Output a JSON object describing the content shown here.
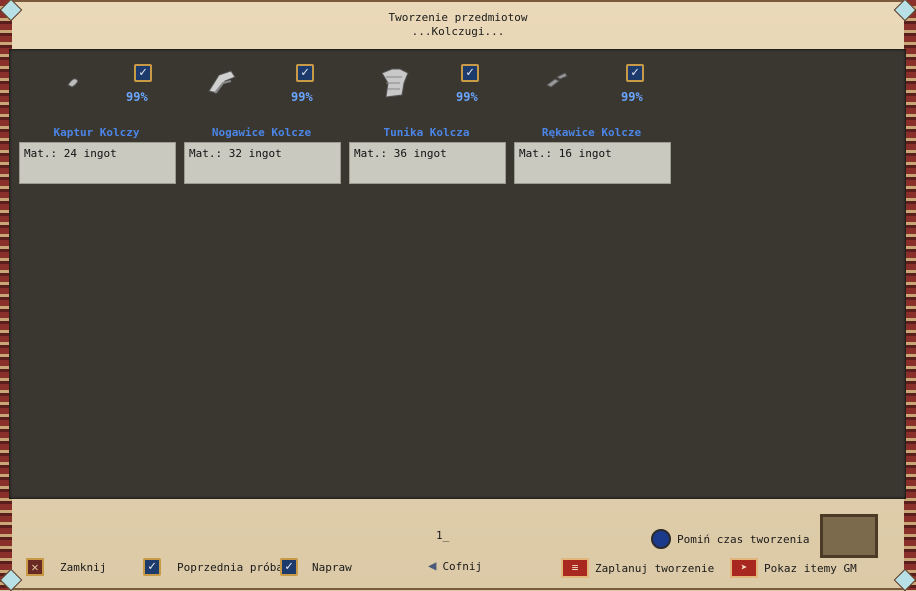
{
  "window": {
    "title": "Tworzenie przedmiotow",
    "subtitle": "...Kolczugi..."
  },
  "items": [
    {
      "name": "Kaptur Kolczy",
      "percent": "99%",
      "material": "Mat.: 24 ingot",
      "icon": "chain-coif-icon"
    },
    {
      "name": "Nogawice Kolcze",
      "percent": "99%",
      "material": "Mat.: 32 ingot",
      "icon": "chain-leggings-icon"
    },
    {
      "name": "Tunika Kolcza",
      "percent": "99%",
      "material": "Mat.: 36 ingot",
      "icon": "chain-tunic-icon"
    },
    {
      "name": "Rękawice Kolcze",
      "percent": "99%",
      "material": "Mat.: 16 ingot",
      "icon": "chain-gloves-icon"
    }
  ],
  "bottom": {
    "quantity": "1_",
    "skip_time": "Pomiń czas tworzenia",
    "close": "Zamknij",
    "previous": "Poprzednia próba",
    "repair": "Napraw",
    "back": "Cofnij",
    "schedule": "Zaplanuj tworzenie",
    "show_gm": "Pokaz itemy GM"
  },
  "colors": {
    "panel": "#3a3630",
    "item_name": "#4b86e8",
    "percent": "#6aa6ff",
    "frame": "#e4d3b2"
  }
}
